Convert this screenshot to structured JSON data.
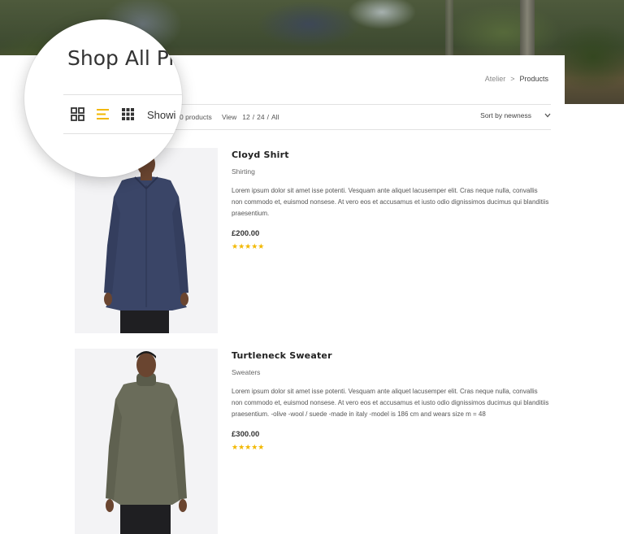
{
  "header": {
    "title": "Shop All Products",
    "title_visible": "Shop All Pro",
    "breadcrumb": {
      "home": "Atelier",
      "separator": ">",
      "current": "Products"
    }
  },
  "toolbar": {
    "showing_visible": "Showi",
    "count_text": "0 products",
    "view_label": "View",
    "view_options": [
      "12",
      "24",
      "All"
    ],
    "view_separator": "/",
    "sort_label": "Sort by newness",
    "layout_icons": [
      "grid-2x2-icon",
      "list-icon",
      "grid-3x3-icon"
    ]
  },
  "products": [
    {
      "name": "Cloyd Shirt",
      "category": "Shirting",
      "description": "Lorem ipsum dolor sit amet isse potenti. Vesquam ante aliquet lacusemper elit. Cras neque nulla, convallis non commodo et, euismod nonsese. At vero eos et accusamus et iusto odio dignissimos ducimus qui blanditiis praesentium.",
      "price": "£200.00",
      "rating": 5,
      "stars": "★★★★★",
      "garment_color": "#3a4567"
    },
    {
      "name": "Turtleneck Sweater",
      "category": "Sweaters",
      "description": "Lorem ipsum dolor sit amet isse potenti. Vesquam ante aliquet lacusemper elit. Cras neque nulla, convallis non commodo et, euismod nonsese. At vero eos et accusamus et iusto odio dignissimos ducimus qui blanditiis praesentium. -olive -wool / suede -made in italy -model is 186 cm and wears size m = 48",
      "price": "£300.00",
      "rating": 5,
      "stars": "★★★★★",
      "garment_color": "#6a6c5a"
    }
  ],
  "colors": {
    "accent_star": "#f2b800",
    "active_icon": "#f2b800",
    "text": "#333333"
  }
}
